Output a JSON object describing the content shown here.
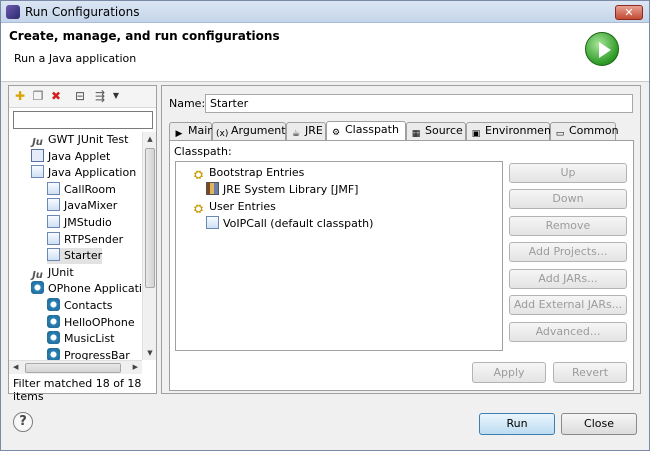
{
  "window": {
    "title": "Run Configurations",
    "close_glyph": "✕"
  },
  "header": {
    "title": "Create, manage, and run configurations",
    "subtitle": "Run a Java application",
    "icon": "run-icon"
  },
  "left": {
    "filter_value": "",
    "tree": [
      {
        "label": "GWT JUnit Test",
        "icon": "junit-icon",
        "level": 0
      },
      {
        "label": "Java Applet",
        "icon": "applet-icon",
        "level": 0
      },
      {
        "label": "Java Application",
        "icon": "java-app-icon",
        "level": 0
      },
      {
        "label": "CallRoom",
        "icon": "java-config-icon",
        "level": 1
      },
      {
        "label": "JavaMixer",
        "icon": "java-config-icon",
        "level": 1
      },
      {
        "label": "JMStudio",
        "icon": "java-config-icon",
        "level": 1
      },
      {
        "label": "RTPSender",
        "icon": "java-config-icon",
        "level": 1
      },
      {
        "label": "Starter",
        "icon": "java-config-icon",
        "level": 1,
        "selected": true
      },
      {
        "label": "JUnit",
        "icon": "junit-icon",
        "level": 0
      },
      {
        "label": "OPhone Applicatio",
        "icon": "ophone-icon",
        "level": 0
      },
      {
        "label": "Contacts",
        "icon": "ophone-icon",
        "level": 1
      },
      {
        "label": "HelloOPhone",
        "icon": "ophone-icon",
        "level": 1
      },
      {
        "label": "MusicList",
        "icon": "ophone-icon",
        "level": 1
      },
      {
        "label": "ProgressBar",
        "icon": "ophone-icon",
        "level": 1
      }
    ],
    "status": "Filter matched 18 of 18 items"
  },
  "right": {
    "name_label": "Name:",
    "name_value": "Starter",
    "tabs": [
      {
        "label": "Main",
        "icon": "main-tab-icon"
      },
      {
        "label": "Arguments",
        "icon": "arguments-tab-icon"
      },
      {
        "label": "JRE",
        "icon": "jre-tab-icon"
      },
      {
        "label": "Classpath",
        "icon": "classpath-tab-icon",
        "active": true
      },
      {
        "label": "Source",
        "icon": "source-tab-icon"
      },
      {
        "label": "Environment",
        "icon": "environment-tab-icon"
      },
      {
        "label": "Common",
        "icon": "common-tab-icon"
      }
    ],
    "classpath_label": "Classpath:",
    "classpath_tree": [
      {
        "label": "Bootstrap Entries",
        "icon": "entries-icon",
        "level": 0
      },
      {
        "label": "JRE System Library [JMF]",
        "icon": "library-icon",
        "level": 1
      },
      {
        "label": "User Entries",
        "icon": "entries-icon",
        "level": 0
      },
      {
        "label": "VoIPCall (default classpath)",
        "icon": "project-icon",
        "level": 1
      }
    ],
    "side_buttons": [
      "Up",
      "Down",
      "Remove",
      "Add Projects...",
      "Add JARs...",
      "Add External JARs...",
      "Advanced..."
    ],
    "apply_label": "Apply",
    "revert_label": "Revert"
  },
  "footer": {
    "help_glyph": "?",
    "run_label": "Run",
    "close_label": "Close"
  }
}
